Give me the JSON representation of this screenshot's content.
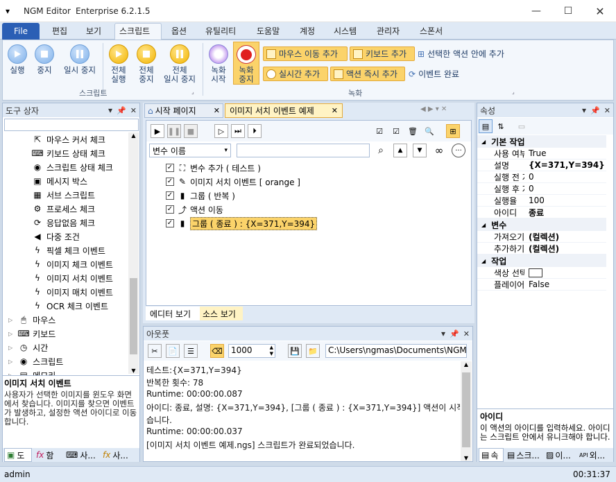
{
  "window": {
    "app_name": "NGM Editor",
    "edition": "Enterprise 6.2.1.5"
  },
  "menu": {
    "file": "File",
    "items": [
      "편집",
      "보기",
      "스크립트",
      "옵션",
      "유틸리티",
      "도움말",
      "계정",
      "시스템",
      "관리자",
      "스폰서"
    ],
    "active": "스크립트"
  },
  "ribbon": {
    "script_group": {
      "label": "스크립트",
      "run": "실행",
      "stop": "중지",
      "pause": "일시 중지",
      "run_all": [
        "전체",
        "실행"
      ],
      "stop_all": [
        "전체",
        "중지"
      ],
      "pause_all": [
        "전체",
        "일시 중지"
      ]
    },
    "record_group": {
      "label": "녹화",
      "record_start": [
        "녹화",
        "시작"
      ],
      "record_stop": [
        "녹화",
        "중지"
      ],
      "add_mouse_move": "마우스 이동 추가",
      "add_keyboard": "키보드 추가",
      "add_in_selected": "선택한 액션 안에 추가",
      "add_realtime": "실시간 추가",
      "add_action_now": "액션 즉시 추가",
      "event_done": "이벤트 완료"
    }
  },
  "toolbox": {
    "title": "도구 상자",
    "items": [
      {
        "label": "마우스 커서 체크",
        "icon": "cursor-icon"
      },
      {
        "label": "키보드 상태 체크",
        "icon": "keyboard-icon"
      },
      {
        "label": "스크립트 상태 체크",
        "icon": "eye-icon"
      },
      {
        "label": "메시지 박스",
        "icon": "message-icon"
      },
      {
        "label": "서브 스크립트",
        "icon": "subscript-icon"
      },
      {
        "label": "프로세스 체크",
        "icon": "process-icon"
      },
      {
        "label": "응답없음 체크",
        "icon": "refresh-icon"
      },
      {
        "label": "다중 조건",
        "icon": "multi-condition-icon"
      },
      {
        "label": "픽셀 체크 이벤트",
        "icon": "lightning-icon"
      },
      {
        "label": "이미지 체크 이벤트",
        "icon": "lightning-icon"
      },
      {
        "label": "이미지 서치 이벤트",
        "icon": "lightning-icon"
      },
      {
        "label": "이미지 매치 이벤트",
        "icon": "lightning-icon"
      },
      {
        "label": "OCR 체크 이벤트",
        "icon": "lightning-icon"
      }
    ],
    "groups": [
      "마우스",
      "키보드",
      "시간",
      "스크립트",
      "메모리"
    ],
    "desc_title": "이미지 서치 이벤트",
    "desc_text": "사용자가 선택한 이미지를 윈도우 화면에서 찾습니다. 이미지를 찾으면 이벤트가 발생하고, 설정한 액션 아이디로 이동합니다.",
    "bottom_tabs": [
      "도",
      "함",
      "사...",
      "사..."
    ]
  },
  "editor": {
    "tabs": [
      {
        "label": "시작 페이지"
      },
      {
        "label": "이미지 서치 이벤트 예제"
      }
    ],
    "var_select": "변수 이름",
    "tree": [
      {
        "label": "변수 추가 ( 테스트 )"
      },
      {
        "label": "이미지 서치 이벤트 [ orange ]"
      },
      {
        "label": "그룹 ( 반복 )"
      },
      {
        "label": "액션 이동"
      },
      {
        "label": "그룹 ( 종료 ) : {X=371,Y=394}"
      }
    ],
    "bottom_tabs": [
      "에디터 보기",
      "소스 보기"
    ]
  },
  "output": {
    "title": "아웃풋",
    "count": "1000",
    "path": "C:\\Users\\ngmas\\Documents\\NGM6\\",
    "lines": [
      "테스트:{X=371,Y=394}",
      "반복한 횟수: 78",
      "Runtime: 00:00:00.087",
      "아이디: 종료, 설명: {X=371,Y=394}, [그룹 ( 종료 )  : {X=371,Y=394}] 액션이 시작되었",
      "습니다.",
      "Runtime: 00:00:00.037",
      "[이미지 서치 이벤트 예제.ngs] 스크립트가 완료되었습니다."
    ]
  },
  "properties": {
    "title": "속성",
    "cat_basic": "기본 작업",
    "basic": [
      {
        "k": "사용 여부",
        "v": "True",
        "bold": false
      },
      {
        "k": "설명",
        "v": "{X=371,Y=394}",
        "bold": true
      },
      {
        "k": "실행 전 지",
        "v": "0",
        "bold": false
      },
      {
        "k": "실행 후 지",
        "v": "0",
        "bold": false
      },
      {
        "k": "실행율",
        "v": "100",
        "bold": false
      },
      {
        "k": "아이디",
        "v": "종료",
        "bold": true
      }
    ],
    "cat_var": "변수",
    "var": [
      {
        "k": "가져오기",
        "v": "(컬렉션)",
        "bold": true
      },
      {
        "k": "추가하기",
        "v": "(컬렉션)",
        "bold": true
      }
    ],
    "cat_work": "작업",
    "work": [
      {
        "k": "색상 선택",
        "v": ""
      },
      {
        "k": "플레이어 :",
        "v": "False"
      }
    ],
    "desc_title": "아이디",
    "desc_text": "이 액션의 아이디를 입력하세요. 아이디는 스크립트 안에서 유니크해야 합니다.",
    "bottom_tabs": [
      "속",
      "스크...",
      "이...",
      "외..."
    ]
  },
  "status": {
    "user": "admin",
    "time": "00:31:37"
  }
}
